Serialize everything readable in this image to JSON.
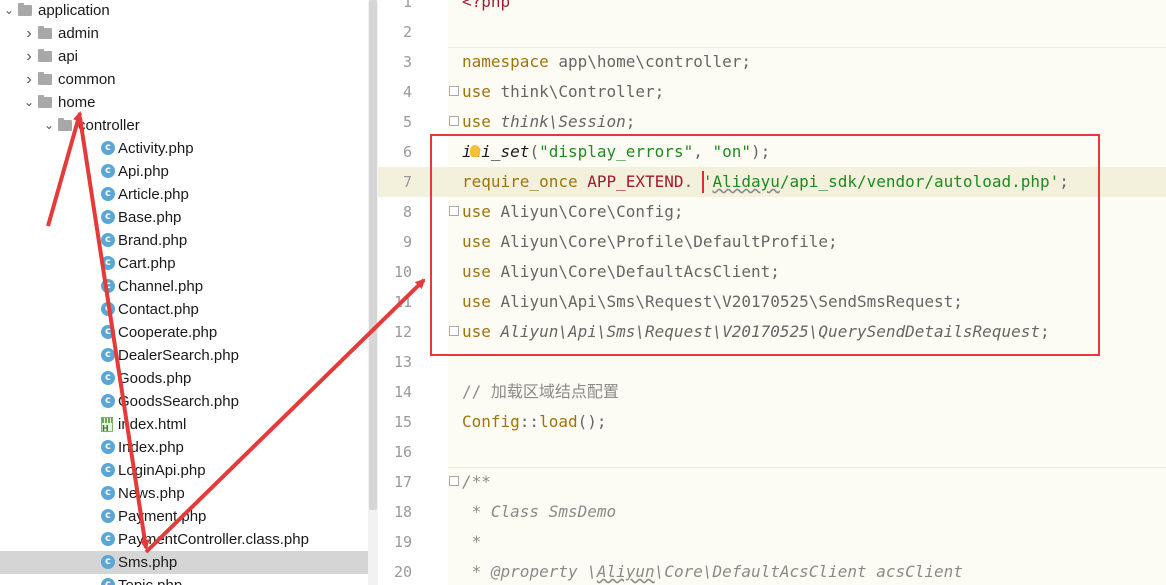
{
  "project_tree": {
    "items": [
      {
        "label": "application",
        "kind": "folder",
        "expanded": true,
        "depth": 0
      },
      {
        "label": "admin",
        "kind": "folder",
        "expanded": false,
        "depth": 1
      },
      {
        "label": "api",
        "kind": "folder",
        "expanded": false,
        "depth": 1
      },
      {
        "label": "common",
        "kind": "folder",
        "expanded": false,
        "depth": 1
      },
      {
        "label": "home",
        "kind": "folder",
        "expanded": true,
        "depth": 1
      },
      {
        "label": "controller",
        "kind": "folder",
        "expanded": true,
        "depth": 2
      },
      {
        "label": "Activity.php",
        "kind": "php-class",
        "depth": 3
      },
      {
        "label": "Api.php",
        "kind": "php-class",
        "depth": 3
      },
      {
        "label": "Article.php",
        "kind": "php-class",
        "depth": 3
      },
      {
        "label": "Base.php",
        "kind": "php-class",
        "depth": 3
      },
      {
        "label": "Brand.php",
        "kind": "php-class",
        "depth": 3
      },
      {
        "label": "Cart.php",
        "kind": "php-class",
        "depth": 3
      },
      {
        "label": "Channel.php",
        "kind": "php-class",
        "depth": 3
      },
      {
        "label": "Contact.php",
        "kind": "php-class",
        "depth": 3
      },
      {
        "label": "Cooperate.php",
        "kind": "php-class",
        "depth": 3
      },
      {
        "label": "DealerSearch.php",
        "kind": "php-class",
        "depth": 3
      },
      {
        "label": "Goods.php",
        "kind": "php-class",
        "depth": 3
      },
      {
        "label": "GoodsSearch.php",
        "kind": "php-class",
        "depth": 3
      },
      {
        "label": "index.html",
        "kind": "html",
        "depth": 3
      },
      {
        "label": "Index.php",
        "kind": "php-class",
        "depth": 3
      },
      {
        "label": "LoginApi.php",
        "kind": "php-class",
        "depth": 3
      },
      {
        "label": "News.php",
        "kind": "php-class",
        "depth": 3
      },
      {
        "label": "Payment.php",
        "kind": "php-class",
        "depth": 3
      },
      {
        "label": "PaymentController.class.php",
        "kind": "php-class",
        "depth": 3
      },
      {
        "label": "Sms.php",
        "kind": "php-class",
        "depth": 3,
        "selected": true
      },
      {
        "label": "Topic.php",
        "kind": "php-class",
        "depth": 3
      }
    ]
  },
  "editor": {
    "current_line": "7",
    "lines": [
      {
        "num": "1",
        "segments": [
          {
            "t": "<?php",
            "c": "const"
          }
        ]
      },
      {
        "num": "2",
        "segments": []
      },
      {
        "num": "3",
        "segments": [
          {
            "t": "namespace",
            "c": "kw"
          },
          {
            "t": " app\\home\\controller;",
            "c": "gray"
          }
        ]
      },
      {
        "num": "4",
        "fold": true,
        "segments": [
          {
            "t": "use",
            "c": "kw"
          },
          {
            "t": " think\\Controller;",
            "c": "gray"
          }
        ]
      },
      {
        "num": "5",
        "fold": true,
        "segments": [
          {
            "t": "use",
            "c": "kw"
          },
          {
            "t": " think\\Session",
            "c": "gray ital"
          },
          {
            "t": ";",
            "c": "gray"
          }
        ]
      },
      {
        "num": "6",
        "segments": [
          {
            "t": "ini_set",
            "c": "fn ital"
          },
          {
            "t": "(",
            "c": "gray"
          },
          {
            "t": "\"display_errors\"",
            "c": "str"
          },
          {
            "t": ", ",
            "c": "gray"
          },
          {
            "t": "\"on\"",
            "c": "str"
          },
          {
            "t": ");",
            "c": "gray"
          }
        ]
      },
      {
        "num": "7",
        "segments": [
          {
            "t": "require_once",
            "c": "kw"
          },
          {
            "t": " ",
            "c": "gray"
          },
          {
            "t": "APP_EXTEND",
            "c": "const"
          },
          {
            "t": ". ",
            "c": "gray"
          },
          {
            "t": "'",
            "c": "str"
          },
          {
            "t": "Alidayu",
            "c": "str wavy"
          },
          {
            "t": "/api_sdk/vendor/autoload.php'",
            "c": "str"
          },
          {
            "t": ";",
            "c": "gray"
          }
        ]
      },
      {
        "num": "8",
        "fold": true,
        "segments": [
          {
            "t": "use",
            "c": "kw"
          },
          {
            "t": " Aliyun\\Core\\Config;",
            "c": "gray"
          }
        ]
      },
      {
        "num": "9",
        "segments": [
          {
            "t": "use",
            "c": "kw"
          },
          {
            "t": " Aliyun\\Core\\Profile\\DefaultProfile;",
            "c": "gray"
          }
        ]
      },
      {
        "num": "10",
        "segments": [
          {
            "t": "use",
            "c": "kw"
          },
          {
            "t": " Aliyun\\Core\\DefaultAcsClient;",
            "c": "gray"
          }
        ]
      },
      {
        "num": "11",
        "segments": [
          {
            "t": "use",
            "c": "kw"
          },
          {
            "t": " Aliyun\\Api\\Sms\\Request\\V20170525\\SendSmsRequest;",
            "c": "gray"
          }
        ]
      },
      {
        "num": "12",
        "fold": true,
        "segments": [
          {
            "t": "use",
            "c": "kw"
          },
          {
            "t": " Aliyun\\Api\\Sms\\Request\\V20170525\\QuerySendDetailsRequest",
            "c": "gray ital"
          },
          {
            "t": ";",
            "c": "gray"
          }
        ]
      },
      {
        "num": "13",
        "segments": []
      },
      {
        "num": "14",
        "segments": [
          {
            "t": "// 加载区域结点配置",
            "c": "comment"
          }
        ]
      },
      {
        "num": "15",
        "segments": [
          {
            "t": "Config",
            "c": "kw"
          },
          {
            "t": "::",
            "c": "gray"
          },
          {
            "t": "load",
            "c": "kw"
          },
          {
            "t": "();",
            "c": "gray"
          }
        ]
      },
      {
        "num": "16",
        "segments": []
      },
      {
        "num": "17",
        "fold": true,
        "segments": [
          {
            "t": "/**",
            "c": "doc"
          }
        ]
      },
      {
        "num": "18",
        "segments": [
          {
            "t": " * Class SmsDemo",
            "c": "doc"
          }
        ]
      },
      {
        "num": "19",
        "segments": [
          {
            "t": " *",
            "c": "doc"
          }
        ]
      },
      {
        "num": "20",
        "segments": [
          {
            "t": " * ",
            "c": "doc"
          },
          {
            "t": "@property",
            "c": "doc"
          },
          {
            "t": " \\",
            "c": "doc"
          },
          {
            "t": "Aliyun",
            "c": "doc wavy"
          },
          {
            "t": "\\Core\\DefaultAcsClient acsClient",
            "c": "doc"
          }
        ]
      }
    ]
  },
  "annotation": {
    "box_color": "#e53a3a"
  }
}
